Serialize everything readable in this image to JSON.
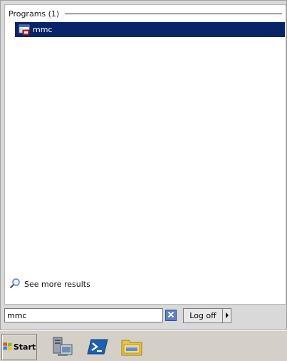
{
  "start_menu": {
    "group_title": "Programs (1)",
    "programs": [
      {
        "label": "mmc",
        "icon": "mmc-console-icon",
        "selected": true
      }
    ],
    "see_more_label": "See more results",
    "search": {
      "value": "mmc"
    },
    "logoff_label": "Log off"
  },
  "taskbar": {
    "start_label": "Start",
    "pinned": [
      {
        "name": "server-manager-icon"
      },
      {
        "name": "powershell-icon"
      },
      {
        "name": "windows-explorer-icon"
      }
    ]
  },
  "colors": {
    "selection": "#0a246a",
    "menu_background": "#d9d9d9",
    "taskbar": "#d4d0c8"
  }
}
